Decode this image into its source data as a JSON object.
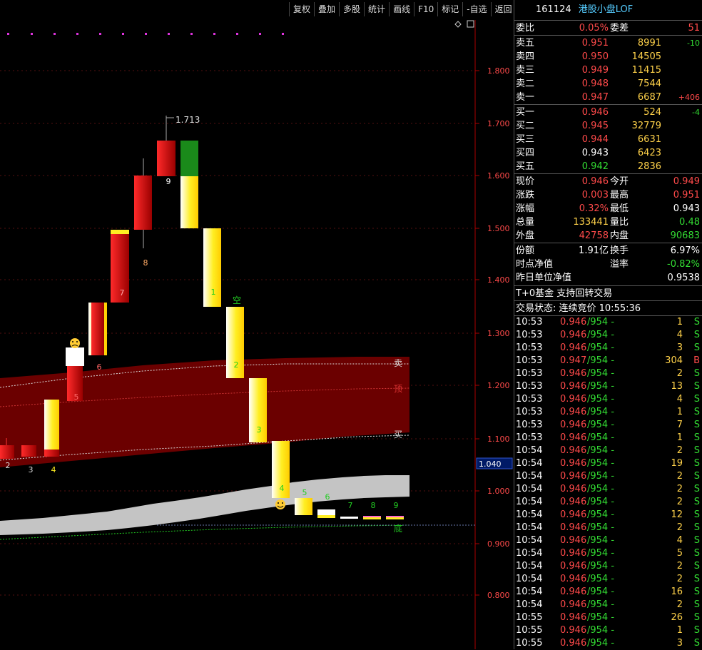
{
  "toolbar": [
    "复权",
    "叠加",
    "多股",
    "统计",
    "画线",
    "F10",
    "标记",
    "-自选",
    "返回"
  ],
  "header": {
    "code": "161124",
    "name": "港股小盘LOF"
  },
  "chart": {
    "y_ticks": [
      "1.800",
      "1.700",
      "1.600",
      "1.500",
      "1.400",
      "1.300",
      "1.200",
      "1.100",
      "1.000",
      "0.900",
      "0.800"
    ],
    "current_price_tag": "1.040",
    "high_label": "1.713",
    "band_labels": {
      "sell": "卖",
      "top": "顶",
      "buy": "买",
      "bottom": "底"
    },
    "kong_label": "空",
    "counts": [
      "2",
      "3",
      "4",
      "5",
      "6",
      "7",
      "8",
      "9",
      "1",
      "2",
      "3",
      "4",
      "5",
      "6",
      "7",
      "8",
      "9"
    ]
  },
  "quote": {
    "weibi": {
      "label": "委比",
      "value": "0.05%",
      "label2": "委差",
      "value2": "51"
    },
    "asks": [
      {
        "label": "卖五",
        "price": "0.951",
        "vol": "8991",
        "chg": "-10"
      },
      {
        "label": "卖四",
        "price": "0.950",
        "vol": "14505",
        "chg": ""
      },
      {
        "label": "卖三",
        "price": "0.949",
        "vol": "11415",
        "chg": ""
      },
      {
        "label": "卖二",
        "price": "0.948",
        "vol": "7544",
        "chg": ""
      },
      {
        "label": "卖一",
        "price": "0.947",
        "vol": "6687",
        "chg": "+406"
      }
    ],
    "bids": [
      {
        "label": "买一",
        "price": "0.946",
        "vol": "524",
        "chg": "-4"
      },
      {
        "label": "买二",
        "price": "0.945",
        "vol": "32779",
        "chg": ""
      },
      {
        "label": "买三",
        "price": "0.944",
        "vol": "6631",
        "chg": ""
      },
      {
        "label": "买四",
        "price": "0.943",
        "vol": "6423",
        "chg": ""
      },
      {
        "label": "买五",
        "price": "0.942",
        "vol": "2836",
        "chg": ""
      }
    ],
    "stats": [
      {
        "l1": "现价",
        "v1": "0.946",
        "l2": "今开",
        "v2": "0.949"
      },
      {
        "l1": "涨跌",
        "v1": "0.003",
        "l2": "最高",
        "v2": "0.951"
      },
      {
        "l1": "涨幅",
        "v1": "0.32%",
        "l2": "最低",
        "v2": "0.943"
      },
      {
        "l1": "总量",
        "v1": "133441",
        "l2": "量比",
        "v2": "0.48"
      },
      {
        "l1": "外盘",
        "v1": "42758",
        "l2": "内盘",
        "v2": "90683"
      }
    ],
    "fund": {
      "fene_label": "份额",
      "fene": "1.91亿",
      "huanshou_label": "换手",
      "huanshou": "6.97%",
      "nav_label": "时点净值",
      "yijia_label": "溢率",
      "yijia": "-0.82%",
      "prev_nav_label": "昨日单位净值",
      "prev_nav": "0.9538"
    },
    "t0": "T+0基金 支持回转交易",
    "status": "交易状态: 连续竞价 10:55:36"
  },
  "ticks": [
    {
      "t": "10:53",
      "p": "0.946",
      "b": "/954",
      "v": "1",
      "s": "S"
    },
    {
      "t": "10:53",
      "p": "0.946",
      "b": "/954",
      "v": "4",
      "s": "S"
    },
    {
      "t": "10:53",
      "p": "0.946",
      "b": "/954",
      "v": "3",
      "s": "S"
    },
    {
      "t": "10:53",
      "p": "0.947",
      "b": "/954",
      "v": "304",
      "s": "B"
    },
    {
      "t": "10:53",
      "p": "0.946",
      "b": "/954",
      "v": "2",
      "s": "S"
    },
    {
      "t": "10:53",
      "p": "0.946",
      "b": "/954",
      "v": "13",
      "s": "S"
    },
    {
      "t": "10:53",
      "p": "0.946",
      "b": "/954",
      "v": "4",
      "s": "S"
    },
    {
      "t": "10:53",
      "p": "0.946",
      "b": "/954",
      "v": "1",
      "s": "S"
    },
    {
      "t": "10:53",
      "p": "0.946",
      "b": "/954",
      "v": "7",
      "s": "S"
    },
    {
      "t": "10:53",
      "p": "0.946",
      "b": "/954",
      "v": "1",
      "s": "S"
    },
    {
      "t": "10:54",
      "p": "0.946",
      "b": "/954",
      "v": "2",
      "s": "S"
    },
    {
      "t": "10:54",
      "p": "0.946",
      "b": "/954",
      "v": "19",
      "s": "S"
    },
    {
      "t": "10:54",
      "p": "0.946",
      "b": "/954",
      "v": "2",
      "s": "S"
    },
    {
      "t": "10:54",
      "p": "0.946",
      "b": "/954",
      "v": "2",
      "s": "S"
    },
    {
      "t": "10:54",
      "p": "0.946",
      "b": "/954",
      "v": "2",
      "s": "S"
    },
    {
      "t": "10:54",
      "p": "0.946",
      "b": "/954",
      "v": "12",
      "s": "S"
    },
    {
      "t": "10:54",
      "p": "0.946",
      "b": "/954",
      "v": "2",
      "s": "S"
    },
    {
      "t": "10:54",
      "p": "0.946",
      "b": "/954",
      "v": "4",
      "s": "S"
    },
    {
      "t": "10:54",
      "p": "0.946",
      "b": "/954",
      "v": "5",
      "s": "S"
    },
    {
      "t": "10:54",
      "p": "0.946",
      "b": "/954",
      "v": "2",
      "s": "S"
    },
    {
      "t": "10:54",
      "p": "0.946",
      "b": "/954",
      "v": "2",
      "s": "S"
    },
    {
      "t": "10:54",
      "p": "0.946",
      "b": "/954",
      "v": "16",
      "s": "S"
    },
    {
      "t": "10:54",
      "p": "0.946",
      "b": "/954",
      "v": "2",
      "s": "S"
    },
    {
      "t": "10:55",
      "p": "0.946",
      "b": "/954",
      "v": "26",
      "s": "S"
    },
    {
      "t": "10:55",
      "p": "0.946",
      "b": "/954",
      "v": "1",
      "s": "S"
    },
    {
      "t": "10:55",
      "p": "0.946",
      "b": "/954",
      "v": "3",
      "s": "S"
    }
  ],
  "colors": {
    "up": "#ff4a4a",
    "down": "#33dd33",
    "band": "#6b0000",
    "candle_yellow": "#ffee22",
    "axis": "#aa0000"
  }
}
